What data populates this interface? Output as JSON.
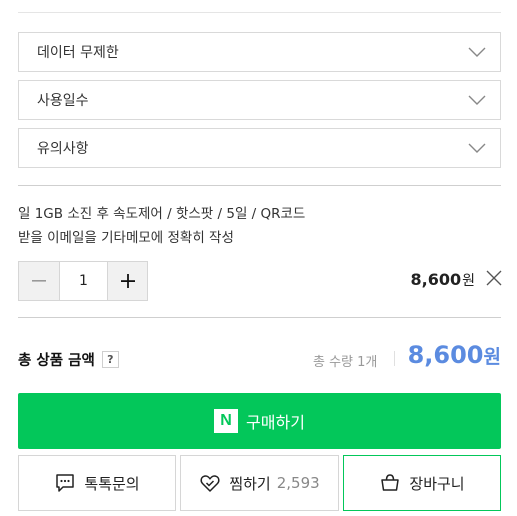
{
  "options": [
    {
      "label": "데이터 무제한"
    },
    {
      "label": "사용일수"
    },
    {
      "label": "유의사항"
    }
  ],
  "description": {
    "line1": "일 1GB 소진 후 속도제어 / 핫스팟 / 5일 / QR코드",
    "line2": "받을 이메일을 기타메모에 정확히 작성"
  },
  "quantity": {
    "minus": "−",
    "value": "1",
    "plus": "+"
  },
  "line_item": {
    "price": "8,600",
    "currency": "원"
  },
  "summary": {
    "label": "총 상품 금액",
    "help": "?",
    "count_text": "총 수량 1개",
    "total_price": "8,600",
    "currency": "원"
  },
  "buy_button": {
    "logo": "N",
    "label": "구매하기"
  },
  "actions": {
    "inquiry_label": "톡톡문의",
    "wish_label": "찜하기",
    "wish_count": "2,593",
    "cart_label": "장바구니"
  },
  "colors": {
    "naver_green": "#03c75a",
    "total_price_blue": "#5b8be0"
  }
}
